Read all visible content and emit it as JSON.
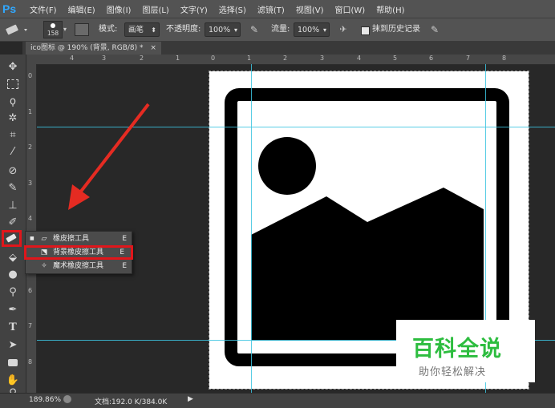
{
  "app": {
    "logo": "Ps"
  },
  "menu": [
    "文件(F)",
    "编辑(E)",
    "图像(I)",
    "图层(L)",
    "文字(Y)",
    "选择(S)",
    "滤镜(T)",
    "视图(V)",
    "窗口(W)",
    "帮助(H)"
  ],
  "options": {
    "brush_size": "158",
    "mode_label": "模式:",
    "mode_value": "画笔",
    "opacity_label": "不透明度:",
    "opacity_value": "100%",
    "flow_label": "流量:",
    "flow_value": "100%",
    "erase_history_label": "抹到历史记录"
  },
  "document": {
    "tab_title": "ico图标 @ 190% (背景, RGB/8) *",
    "tab_close": "×"
  },
  "rulers": {
    "top": [
      "4",
      "3",
      "2",
      "1",
      "0",
      "1",
      "2",
      "3",
      "4",
      "5",
      "6",
      "7",
      "8"
    ],
    "left": [
      "0",
      "1",
      "2",
      "3",
      "4",
      "5",
      "6",
      "7",
      "8"
    ]
  },
  "flyout": {
    "items": [
      {
        "dot": "■",
        "label": "橡皮擦工具",
        "key": "E"
      },
      {
        "dot": "",
        "label": "背景橡皮擦工具",
        "key": "E"
      },
      {
        "dot": "",
        "label": "魔术橡皮擦工具",
        "key": "E"
      }
    ]
  },
  "status": {
    "zoom": "189.86%",
    "doc_info": "文档:192.0 K/384.0K"
  },
  "watermark": {
    "title": "百科全说",
    "subtitle": "助你轻松解决"
  },
  "colors": {
    "highlight": "#e0161b",
    "arrow": "#e52b22",
    "guide": "#3cc4e0",
    "watermark_green": "#2dbd3f"
  }
}
